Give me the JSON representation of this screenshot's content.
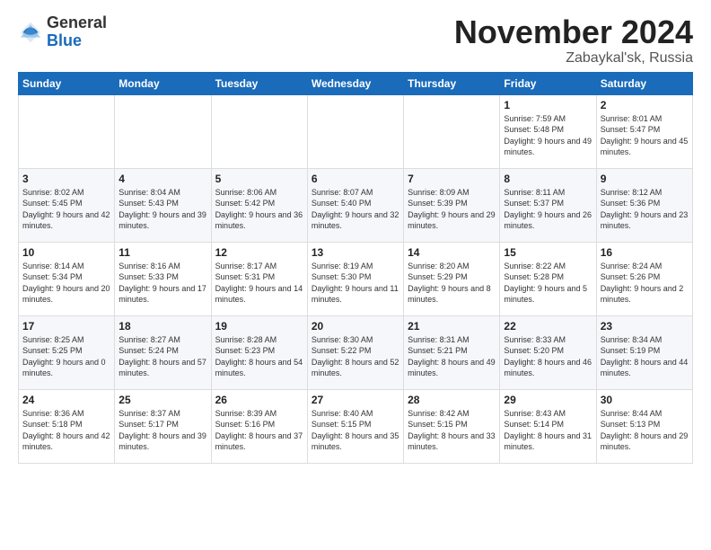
{
  "logo": {
    "general": "General",
    "blue": "Blue"
  },
  "header": {
    "month": "November 2024",
    "location": "Zabaykal'sk, Russia"
  },
  "weekdays": [
    "Sunday",
    "Monday",
    "Tuesday",
    "Wednesday",
    "Thursday",
    "Friday",
    "Saturday"
  ],
  "weeks": [
    [
      {
        "day": "",
        "info": ""
      },
      {
        "day": "",
        "info": ""
      },
      {
        "day": "",
        "info": ""
      },
      {
        "day": "",
        "info": ""
      },
      {
        "day": "",
        "info": ""
      },
      {
        "day": "1",
        "info": "Sunrise: 7:59 AM\nSunset: 5:48 PM\nDaylight: 9 hours\nand 49 minutes."
      },
      {
        "day": "2",
        "info": "Sunrise: 8:01 AM\nSunset: 5:47 PM\nDaylight: 9 hours\nand 45 minutes."
      }
    ],
    [
      {
        "day": "3",
        "info": "Sunrise: 8:02 AM\nSunset: 5:45 PM\nDaylight: 9 hours\nand 42 minutes."
      },
      {
        "day": "4",
        "info": "Sunrise: 8:04 AM\nSunset: 5:43 PM\nDaylight: 9 hours\nand 39 minutes."
      },
      {
        "day": "5",
        "info": "Sunrise: 8:06 AM\nSunset: 5:42 PM\nDaylight: 9 hours\nand 36 minutes."
      },
      {
        "day": "6",
        "info": "Sunrise: 8:07 AM\nSunset: 5:40 PM\nDaylight: 9 hours\nand 32 minutes."
      },
      {
        "day": "7",
        "info": "Sunrise: 8:09 AM\nSunset: 5:39 PM\nDaylight: 9 hours\nand 29 minutes."
      },
      {
        "day": "8",
        "info": "Sunrise: 8:11 AM\nSunset: 5:37 PM\nDaylight: 9 hours\nand 26 minutes."
      },
      {
        "day": "9",
        "info": "Sunrise: 8:12 AM\nSunset: 5:36 PM\nDaylight: 9 hours\nand 23 minutes."
      }
    ],
    [
      {
        "day": "10",
        "info": "Sunrise: 8:14 AM\nSunset: 5:34 PM\nDaylight: 9 hours\nand 20 minutes."
      },
      {
        "day": "11",
        "info": "Sunrise: 8:16 AM\nSunset: 5:33 PM\nDaylight: 9 hours\nand 17 minutes."
      },
      {
        "day": "12",
        "info": "Sunrise: 8:17 AM\nSunset: 5:31 PM\nDaylight: 9 hours\nand 14 minutes."
      },
      {
        "day": "13",
        "info": "Sunrise: 8:19 AM\nSunset: 5:30 PM\nDaylight: 9 hours\nand 11 minutes."
      },
      {
        "day": "14",
        "info": "Sunrise: 8:20 AM\nSunset: 5:29 PM\nDaylight: 9 hours\nand 8 minutes."
      },
      {
        "day": "15",
        "info": "Sunrise: 8:22 AM\nSunset: 5:28 PM\nDaylight: 9 hours\nand 5 minutes."
      },
      {
        "day": "16",
        "info": "Sunrise: 8:24 AM\nSunset: 5:26 PM\nDaylight: 9 hours\nand 2 minutes."
      }
    ],
    [
      {
        "day": "17",
        "info": "Sunrise: 8:25 AM\nSunset: 5:25 PM\nDaylight: 9 hours\nand 0 minutes."
      },
      {
        "day": "18",
        "info": "Sunrise: 8:27 AM\nSunset: 5:24 PM\nDaylight: 8 hours\nand 57 minutes."
      },
      {
        "day": "19",
        "info": "Sunrise: 8:28 AM\nSunset: 5:23 PM\nDaylight: 8 hours\nand 54 minutes."
      },
      {
        "day": "20",
        "info": "Sunrise: 8:30 AM\nSunset: 5:22 PM\nDaylight: 8 hours\nand 52 minutes."
      },
      {
        "day": "21",
        "info": "Sunrise: 8:31 AM\nSunset: 5:21 PM\nDaylight: 8 hours\nand 49 minutes."
      },
      {
        "day": "22",
        "info": "Sunrise: 8:33 AM\nSunset: 5:20 PM\nDaylight: 8 hours\nand 46 minutes."
      },
      {
        "day": "23",
        "info": "Sunrise: 8:34 AM\nSunset: 5:19 PM\nDaylight: 8 hours\nand 44 minutes."
      }
    ],
    [
      {
        "day": "24",
        "info": "Sunrise: 8:36 AM\nSunset: 5:18 PM\nDaylight: 8 hours\nand 42 minutes."
      },
      {
        "day": "25",
        "info": "Sunrise: 8:37 AM\nSunset: 5:17 PM\nDaylight: 8 hours\nand 39 minutes."
      },
      {
        "day": "26",
        "info": "Sunrise: 8:39 AM\nSunset: 5:16 PM\nDaylight: 8 hours\nand 37 minutes."
      },
      {
        "day": "27",
        "info": "Sunrise: 8:40 AM\nSunset: 5:15 PM\nDaylight: 8 hours\nand 35 minutes."
      },
      {
        "day": "28",
        "info": "Sunrise: 8:42 AM\nSunset: 5:15 PM\nDaylight: 8 hours\nand 33 minutes."
      },
      {
        "day": "29",
        "info": "Sunrise: 8:43 AM\nSunset: 5:14 PM\nDaylight: 8 hours\nand 31 minutes."
      },
      {
        "day": "30",
        "info": "Sunrise: 8:44 AM\nSunset: 5:13 PM\nDaylight: 8 hours\nand 29 minutes."
      }
    ]
  ]
}
